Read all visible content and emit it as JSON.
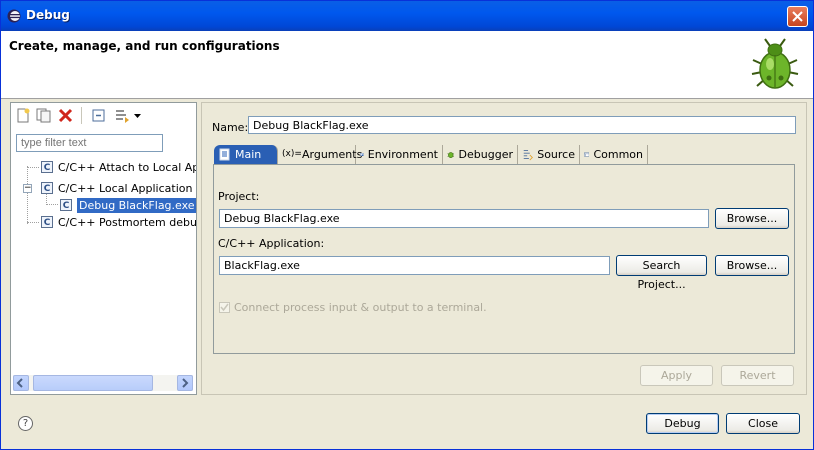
{
  "window": {
    "title": "Debug"
  },
  "banner": {
    "title": "Create, manage, and run configurations"
  },
  "left": {
    "filter_placeholder": "type filter text",
    "tree": [
      {
        "label": "C/C++ Attach to Local Appl"
      },
      {
        "label": "C/C++ Local Application"
      },
      {
        "label": "Debug BlackFlag.exe"
      },
      {
        "label": "C/C++ Postmortem debugg"
      }
    ]
  },
  "right": {
    "name_label": "Name:",
    "name_value": "Debug BlackFlag.exe",
    "tabs": [
      {
        "label": "Main",
        "icon": "main-tab-icon"
      },
      {
        "label": "Arguments",
        "icon": "arguments-icon"
      },
      {
        "label": "Environment",
        "icon": "environment-icon"
      },
      {
        "label": "Debugger",
        "icon": "debugger-icon"
      },
      {
        "label": "Source",
        "icon": "source-icon"
      },
      {
        "label": "Common",
        "icon": "common-icon"
      }
    ],
    "project_label": "Project:",
    "project_value": "Debug BlackFlag.exe",
    "browse_label": "Browse...",
    "app_label": "C/C++ Application:",
    "app_value": "BlackFlag.exe",
    "search_project_label": "Search Project...",
    "browse2_label": "Browse...",
    "checkbox_label": "Connect process input & output to a terminal.",
    "apply_label": "Apply",
    "revert_label": "Revert"
  },
  "footer": {
    "help_glyph": "?",
    "debug_label": "Debug",
    "close_label": "Close"
  },
  "colors": {
    "titlebar": "#0058ee",
    "selection": "#316ac5",
    "close": "#c6441e"
  }
}
